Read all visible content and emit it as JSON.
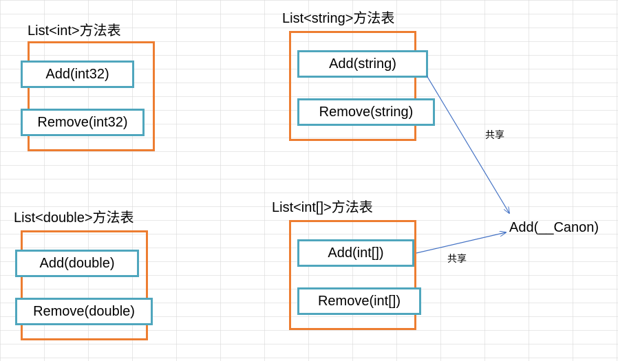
{
  "tables": {
    "int": {
      "title": "List<int>方法表",
      "methods": {
        "add": "Add(int32)",
        "remove": "Remove(int32)"
      }
    },
    "double": {
      "title": "List<double>方法表",
      "methods": {
        "add": "Add(double)",
        "remove": "Remove(double)"
      }
    },
    "string": {
      "title": "List<string>方法表",
      "methods": {
        "add": "Add(string)",
        "remove": "Remove(string)"
      }
    },
    "intarr": {
      "title": "List<int[]>方法表",
      "methods": {
        "add": "Add(int[])",
        "remove": "Remove(int[])"
      }
    }
  },
  "shared": {
    "target": "Add(__Canon)",
    "label1": "共享",
    "label2": "共享"
  }
}
